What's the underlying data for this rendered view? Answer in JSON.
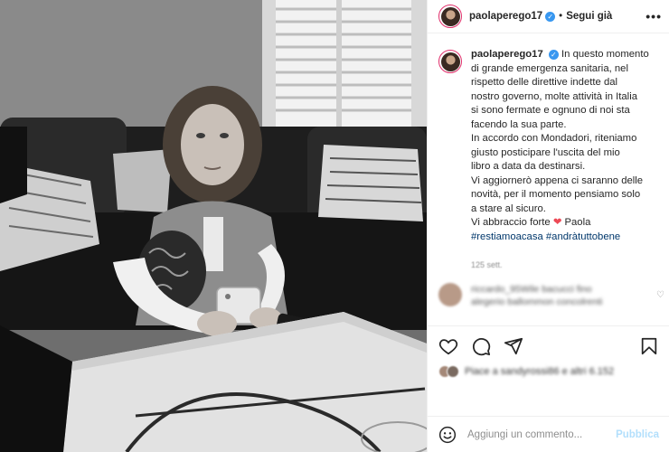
{
  "header": {
    "username": "paolaperego17",
    "separator": "•",
    "follow_label": "Segui già",
    "more_label": "•••"
  },
  "caption": {
    "username": "paolaperego17",
    "lines": [
      "In questo momento",
      "di grande emergenza sanitaria, nel",
      "rispetto delle direttive indette dal",
      "nostro governo, molte attività in Italia",
      "si sono fermate e ognuno di noi sta",
      "facendo la sua parte.",
      "In accordo con Mondadori, riteniamo",
      "giusto posticipare l'uscita del mio",
      "libro a data da destinarsi.",
      "Vi aggiornerò appena ci saranno delle",
      "novità, per il momento pensiamo solo",
      "a stare al sicuro.",
      "Vi abbraccio forte",
      "Paola"
    ],
    "heart": "❤",
    "hashtags": "#restiamoacasa #andràtuttobene",
    "time": "125 sett."
  },
  "comment": {
    "text_line1": "riccardo_95Wile bacucci fino",
    "text_line2": "alegerio ballommon concolrenti"
  },
  "likes": {
    "text": "Piace a sandyrossi86 e altri 6.152"
  },
  "add_comment": {
    "placeholder": "Aggiungi un commento...",
    "publish_label": "Pubblica"
  },
  "icons": {
    "like": "heart-icon",
    "comment": "comment-icon",
    "share": "share-icon",
    "save": "bookmark-icon",
    "emoji": "emoji-icon",
    "verified": "verified-badge-icon"
  },
  "colors": {
    "verified": "#3897f0",
    "heart": "#ed4956",
    "hashtag": "#00376b",
    "publish": "#b2dffc",
    "story_ring": "#e1306c"
  }
}
